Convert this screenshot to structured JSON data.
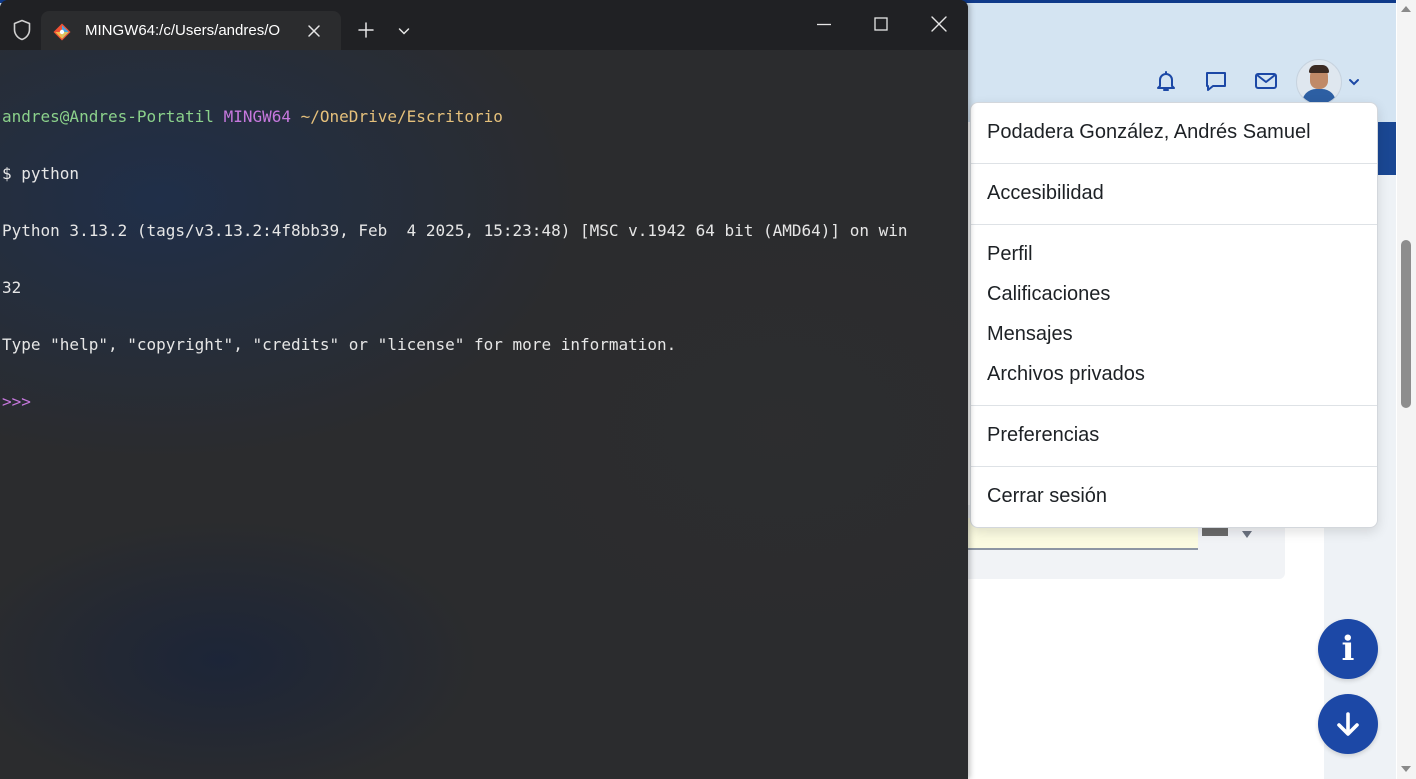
{
  "terminal": {
    "tab_title": "MINGW64:/c/Users/andres/O",
    "prompt_user": "andres@Andres-Portatil",
    "prompt_system": "MINGW64",
    "prompt_path": "~/OneDrive/Escritorio",
    "command_line": "$ python",
    "output_lines": [
      "Python 3.13.2 (tags/v3.13.2:4f8bb39, Feb  4 2025, 15:23:48) [MSC v.1942 64 bit (AMD64)] on win",
      "32",
      "Type \"help\", \"copyright\", \"credits\" or \"license\" for more information."
    ],
    "repl_prompt": ">>>"
  },
  "header": {
    "icons": [
      "bell-icon",
      "chat-icon",
      "mail-icon"
    ]
  },
  "user_menu": {
    "user_name": "Podadera González, Andrés Samuel",
    "accessibility": "Accesibilidad",
    "profile": "Perfil",
    "grades": "Calificaciones",
    "messages": "Mensajes",
    "private_files": "Archivos privados",
    "preferences": "Preferencias",
    "logout": "Cerrar sesión"
  },
  "fab": {
    "info_glyph": "i"
  },
  "colors": {
    "terminal_bg": "#2b2c2e",
    "titlebar_bg": "#202124",
    "header_bg": "#d4e4f2",
    "brand_blue": "#1c48a6",
    "prompt_green": "#8bd18b",
    "prompt_magenta": "#c678dd",
    "prompt_yellow": "#e5c07b"
  }
}
